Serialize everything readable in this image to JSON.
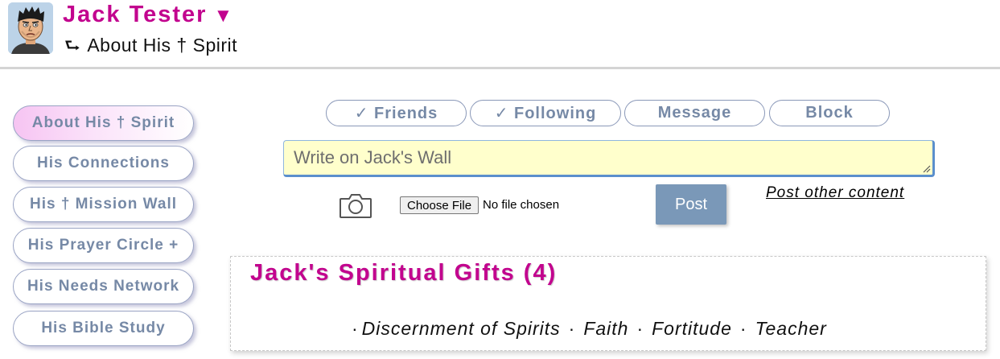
{
  "profile": {
    "name": "Jack Tester",
    "caret": "▼",
    "breadcrumb_arrow": "⮑",
    "breadcrumb": "About His † Spirit"
  },
  "sidebar": {
    "items": [
      {
        "label": "About His † Spirit",
        "active": true
      },
      {
        "label": "His Connections",
        "active": false
      },
      {
        "label": "His † Mission Wall",
        "active": false
      },
      {
        "label": "His Prayer Circle +",
        "active": false
      },
      {
        "label": "His Needs Network",
        "active": false
      },
      {
        "label": "His Bible Study",
        "active": false
      }
    ]
  },
  "actions": {
    "friends": "✓ Friends",
    "following": "✓ Following",
    "message": "Message",
    "block": "Block"
  },
  "wall": {
    "placeholder": "Write on Jack's Wall",
    "choose_file_label": "Choose File",
    "no_file_text": "No file chosen",
    "post_label": "Post",
    "post_other_label": "Post other content"
  },
  "gifts": {
    "title": "Jack's Spiritual Gifts (4)",
    "lead_marker": "·",
    "separator": "·",
    "items": [
      "Discernment of Spirits",
      "Faith",
      "Fortitude",
      "Teacher"
    ]
  },
  "colors": {
    "brand": "#c2048e",
    "button_text": "#7689a6",
    "post_button": "#7a98b8",
    "input_bg": "#ffffcc"
  }
}
